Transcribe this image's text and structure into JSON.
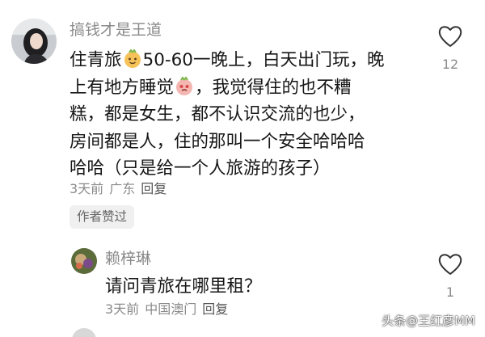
{
  "comment": {
    "username": "搞钱才是王道",
    "lines": [
      [
        "住青旅",
        "50-60一晚上，白天出门玩，晚"
      ],
      [
        "上有地方睡觉",
        "，我觉得住的也不糟"
      ],
      [
        "糕，都是女生，都不认识交流的也少，"
      ],
      [
        "房间都是人，住的那叫一个安全哈哈哈"
      ],
      [
        "哈哈（只是给一个人旅游的孩子）"
      ]
    ],
    "time": "3天前",
    "location": "广东",
    "reply_label": "回复",
    "badge": "作者赞过",
    "likes": "12",
    "icons": {
      "emoji1": "smiling-face-emoji",
      "emoji2": "pleading-face-emoji",
      "like": "heart-icon"
    }
  },
  "reply": {
    "username": "赖梓琳",
    "text": "请问青旅在哪里租？",
    "time": "3天前",
    "location": "中国澳门",
    "reply_label": "回复",
    "likes": "1"
  },
  "watermark": "头条@王红彦MM"
}
